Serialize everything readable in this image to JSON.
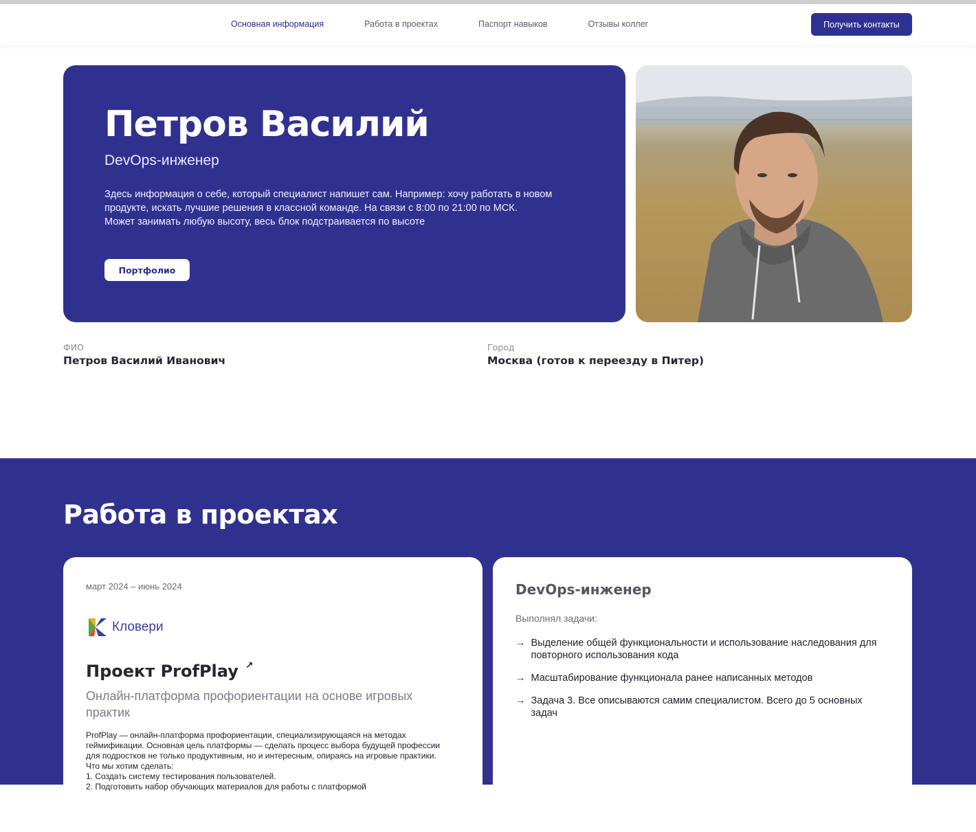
{
  "nav": {
    "items": [
      "Основная информация",
      "Работа в проектах",
      "Паспорт навыков",
      "Отзывы коллег"
    ],
    "cta_label": "Получить контакты"
  },
  "hero": {
    "name": "Петров Василий",
    "role": "DevOps-инженер",
    "about": [
      "Здесь информация о себе, который специалист напишет сам. Например: хочу работать в новом",
      "продукте, искать лучшие решения в классной команде. На связи с 8:00 по 21:00 по МСК.",
      "Может занимать любую высоту, весь блок подстраивается по высоте"
    ],
    "portfolio_label": "Портфолио"
  },
  "facts": {
    "fio_label": "ФИО",
    "fio_value": "Петров Василий Иванович",
    "city_label": "Город",
    "city_value": "Москва (готов к переезду в Питер)"
  },
  "projects": {
    "title": "Работа в проектах",
    "card": {
      "period": "март 2024 – июнь 2024",
      "company": "Кловери",
      "project_title": "Проект ProfPlay",
      "subtitle": "Онлайн-платформа профориентации на основе игровых практик",
      "description": [
        "ProfPlay — онлайн-платформа профориентации, специализирующаяся на методах",
        "геймификации. Основная цель платформы — сделать процесс выбора будущей профессии",
        "для подростков не только продуктивным, но и интересным, опираясь на игровые практики.",
        "Что мы хотим сделать:",
        "1. Создать систему тестирования пользователей.",
        "2. Подготовить набор обучающих материалов для работы с платформой"
      ]
    },
    "role_card": {
      "role": "DevOps-инженер",
      "tasks_label": "Выполнял задачи:",
      "tasks": [
        "Выделение общей функциональности и использование наследования для повторного использования кода",
        "Масштабирование функционала ранее написанных методов",
        "Задача 3. Все описываются самим специалистом. Всего до 5 основных задач"
      ]
    }
  },
  "colors": {
    "brand": "#30318f",
    "cta": "#2e3191"
  }
}
